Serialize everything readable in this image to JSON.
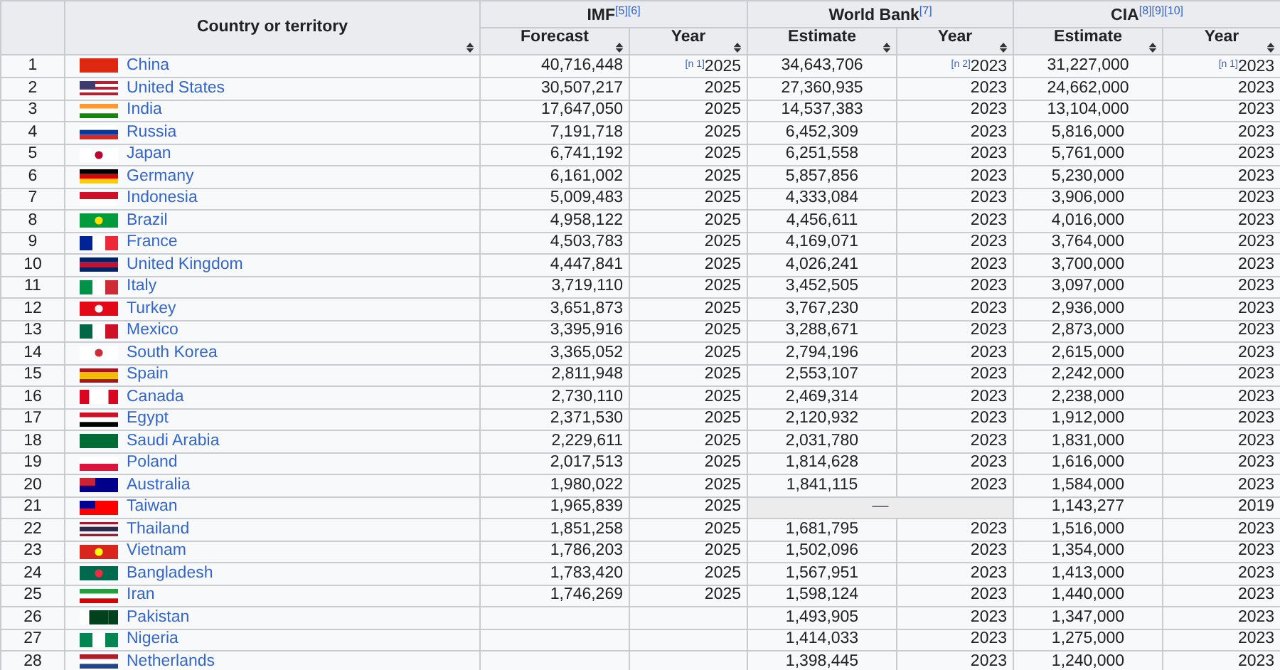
{
  "table": {
    "country_header": "Country or territory",
    "groups": [
      {
        "label": "IMF$^{[5][6]}$",
        "columns": [
          "Forecast",
          "Year"
        ]
      },
      {
        "label": "World Bank$^{[7]}$",
        "columns": [
          "Estimate",
          "Year"
        ]
      },
      {
        "label": "CIA$^{[8][9][10]}$",
        "columns": [
          "Estimate",
          "Year"
        ]
      }
    ],
    "rows": [
      {
        "rank": "1",
        "country": "China",
        "imf": [
          "40,716,448",
          "$^{[n 1]}$2025"
        ],
        "wb": [
          "34,643,706",
          "$^{[n 2]}$2023"
        ],
        "cia": [
          "31,227,000",
          "$^{[n 1]}$2023"
        ]
      },
      {
        "rank": "2",
        "country": "United States",
        "imf": [
          "30,507,217",
          "2025"
        ],
        "wb": [
          "27,360,935",
          "2023"
        ],
        "cia": [
          "24,662,000",
          "2023"
        ]
      },
      {
        "rank": "3",
        "country": "India",
        "imf": [
          "17,647,050",
          "2025"
        ],
        "wb": [
          "14,537,383",
          "2023"
        ],
        "cia": [
          "13,104,000",
          "2023"
        ]
      },
      {
        "rank": "4",
        "country": "Russia",
        "imf": [
          "7,191,718",
          "2025"
        ],
        "wb": [
          "6,452,309",
          "2023"
        ],
        "cia": [
          "5,816,000",
          "2023"
        ]
      },
      {
        "rank": "5",
        "country": "Japan",
        "imf": [
          "6,741,192",
          "2025"
        ],
        "wb": [
          "6,251,558",
          "2023"
        ],
        "cia": [
          "5,761,000",
          "2023"
        ]
      },
      {
        "rank": "6",
        "country": "Germany",
        "imf": [
          "6,161,002",
          "2025"
        ],
        "wb": [
          "5,857,856",
          "2023"
        ],
        "cia": [
          "5,230,000",
          "2023"
        ]
      },
      {
        "rank": "7",
        "country": "Indonesia",
        "imf": [
          "5,009,483",
          "2025"
        ],
        "wb": [
          "4,333,084",
          "2023"
        ],
        "cia": [
          "3,906,000",
          "2023"
        ]
      },
      {
        "rank": "8",
        "country": "Brazil",
        "imf": [
          "4,958,122",
          "2025"
        ],
        "wb": [
          "4,456,611",
          "2023"
        ],
        "cia": [
          "4,016,000",
          "2023"
        ]
      },
      {
        "rank": "9",
        "country": "France",
        "imf": [
          "4,503,783",
          "2025"
        ],
        "wb": [
          "4,169,071",
          "2023"
        ],
        "cia": [
          "3,764,000",
          "2023"
        ]
      },
      {
        "rank": "10",
        "country": "United Kingdom",
        "imf": [
          "4,447,841",
          "2025"
        ],
        "wb": [
          "4,026,241",
          "2023"
        ],
        "cia": [
          "3,700,000",
          "2023"
        ]
      },
      {
        "rank": "11",
        "country": "Italy",
        "imf": [
          "3,719,110",
          "2025"
        ],
        "wb": [
          "3,452,505",
          "2023"
        ],
        "cia": [
          "3,097,000",
          "2023"
        ]
      },
      {
        "rank": "12",
        "country": "Turkey",
        "imf": [
          "3,651,873",
          "2025"
        ],
        "wb": [
          "3,767,230",
          "2023"
        ],
        "cia": [
          "2,936,000",
          "2023"
        ]
      },
      {
        "rank": "13",
        "country": "Mexico",
        "imf": [
          "3,395,916",
          "2025"
        ],
        "wb": [
          "3,288,671",
          "2023"
        ],
        "cia": [
          "2,873,000",
          "2023"
        ]
      },
      {
        "rank": "14",
        "country": "South Korea",
        "imf": [
          "3,365,052",
          "2025"
        ],
        "wb": [
          "2,794,196",
          "2023"
        ],
        "cia": [
          "2,615,000",
          "2023"
        ]
      },
      {
        "rank": "15",
        "country": "Spain",
        "imf": [
          "2,811,948",
          "2025"
        ],
        "wb": [
          "2,553,107",
          "2023"
        ],
        "cia": [
          "2,242,000",
          "2023"
        ]
      },
      {
        "rank": "16",
        "country": "Canada",
        "imf": [
          "2,730,110",
          "2025"
        ],
        "wb": [
          "2,469,314",
          "2023"
        ],
        "cia": [
          "2,238,000",
          "2023"
        ]
      },
      {
        "rank": "17",
        "country": "Egypt",
        "imf": [
          "2,371,530",
          "2025"
        ],
        "wb": [
          "2,120,932",
          "2023"
        ],
        "cia": [
          "1,912,000",
          "2023"
        ]
      },
      {
        "rank": "18",
        "country": "Saudi Arabia",
        "imf": [
          "2,229,611",
          "2025"
        ],
        "wb": [
          "2,031,780",
          "2023"
        ],
        "cia": [
          "1,831,000",
          "2023"
        ]
      },
      {
        "rank": "19",
        "country": "Poland",
        "imf": [
          "2,017,513",
          "2025"
        ],
        "wb": [
          "1,814,628",
          "2023"
        ],
        "cia": [
          "1,616,000",
          "2023"
        ]
      },
      {
        "rank": "20",
        "country": "Australia",
        "imf": [
          "1,980,022",
          "2025"
        ],
        "wb": [
          "1,841,115",
          "2023"
        ],
        "cia": [
          "1,584,000",
          "2023"
        ]
      },
      {
        "rank": "21",
        "country": "Taiwan",
        "imf": [
          "1,965,839",
          "2025"
        ],
        "wb_note": "—",
        "cia": [
          "1,143,277",
          "2019"
        ]
      },
      {
        "rank": "22",
        "country": "Thailand",
        "imf": [
          "1,851,258",
          "2025"
        ],
        "wb": [
          "1,681,795",
          "2023"
        ],
        "cia": [
          "1,516,000",
          "2023"
        ]
      },
      {
        "rank": "23",
        "country": "Vietnam",
        "imf": [
          "1,786,203",
          "2025"
        ],
        "wb": [
          "1,502,096",
          "2023"
        ],
        "cia": [
          "1,354,000",
          "2023"
        ]
      },
      {
        "rank": "24",
        "country": "Bangladesh",
        "imf": [
          "1,783,420",
          "2025"
        ],
        "wb": [
          "1,567,951",
          "2023"
        ],
        "cia": [
          "1,413,000",
          "2023"
        ]
      },
      {
        "rank": "25",
        "country": "Iran",
        "imf": [
          "1,746,269",
          "2025"
        ],
        "wb": [
          "1,598,124",
          "2023"
        ],
        "cia": [
          "1,440,000",
          "2023"
        ]
      },
      {
        "rank": "26",
        "country": "Pakistan",
        "wb": [
          "1,493,905",
          "2023"
        ],
        "cia": [
          "1,347,000",
          "2023"
        ]
      },
      {
        "rank": "27",
        "country": "Nigeria",
        "wb": [
          "1,414,033",
          "2023"
        ],
        "cia": [
          "1,275,000",
          "2023"
        ]
      },
      {
        "rank": "28",
        "country": "Netherlands",
        "wb": [
          "1,398,445",
          "2023"
        ],
        "cia": [
          "1,240,000",
          "2023"
        ]
      }
    ]
  }
}
